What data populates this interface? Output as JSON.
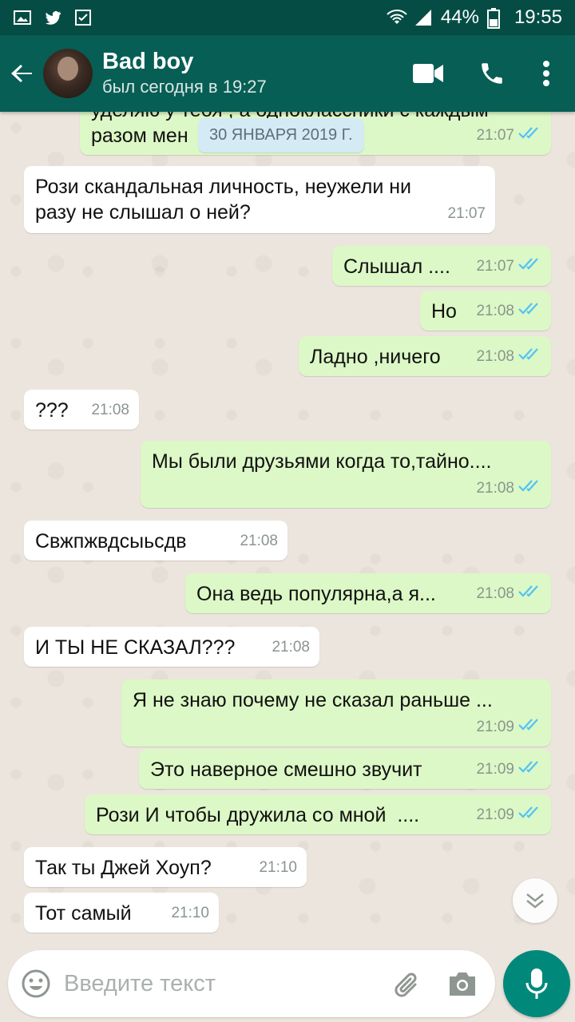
{
  "status_bar": {
    "battery": "44%",
    "time": "19:55"
  },
  "header": {
    "name": "Bad boy",
    "status": "был сегодня в 19:27"
  },
  "date_chip": "30 ЯНВАРЯ 2019 Г.",
  "messages": [
    {
      "text": "уделяю у тебя , а одноклассники с каждым\nразом мен",
      "time": "21:07",
      "dir": "out"
    },
    {
      "text": "Рози скандальная личность, неужели ни\nразу не слышал о ней?",
      "time": "21:07",
      "dir": "in"
    },
    {
      "text": "Слышал ....",
      "time": "21:07",
      "dir": "out"
    },
    {
      "text": "Но",
      "time": "21:08",
      "dir": "out"
    },
    {
      "text": "Ладно ,ничего",
      "time": "21:08",
      "dir": "out"
    },
    {
      "text": "???",
      "time": "21:08",
      "dir": "in"
    },
    {
      "text": "Мы были друзьями когда то,тайно....",
      "time": "21:08",
      "dir": "out"
    },
    {
      "text": "Свжпжвдсыьсдв",
      "time": "21:08",
      "dir": "in"
    },
    {
      "text": "Она ведь популярна,а я...",
      "time": "21:08",
      "dir": "out"
    },
    {
      "text": "И ТЫ НЕ СКАЗАЛ???",
      "time": "21:08",
      "dir": "in"
    },
    {
      "text": "Я не знаю почему не сказал раньше ...",
      "time": "21:09",
      "dir": "out"
    },
    {
      "text": "Это наверное смешно звучит",
      "time": "21:09",
      "dir": "out"
    },
    {
      "text": "Рози И чтобы дружила со мной  ....",
      "time": "21:09",
      "dir": "out"
    },
    {
      "text": "Так ты Джей Хоуп?",
      "time": "21:10",
      "dir": "in"
    },
    {
      "text": "Тот самый",
      "time": "21:10",
      "dir": "in"
    }
  ],
  "composer": {
    "placeholder": "Введите текст"
  },
  "colors": {
    "header": "#075e54",
    "outgoing": "#dcf8c6",
    "incoming": "#ffffff",
    "read_ticks": "#4fc3f7",
    "fab": "#00897b"
  }
}
